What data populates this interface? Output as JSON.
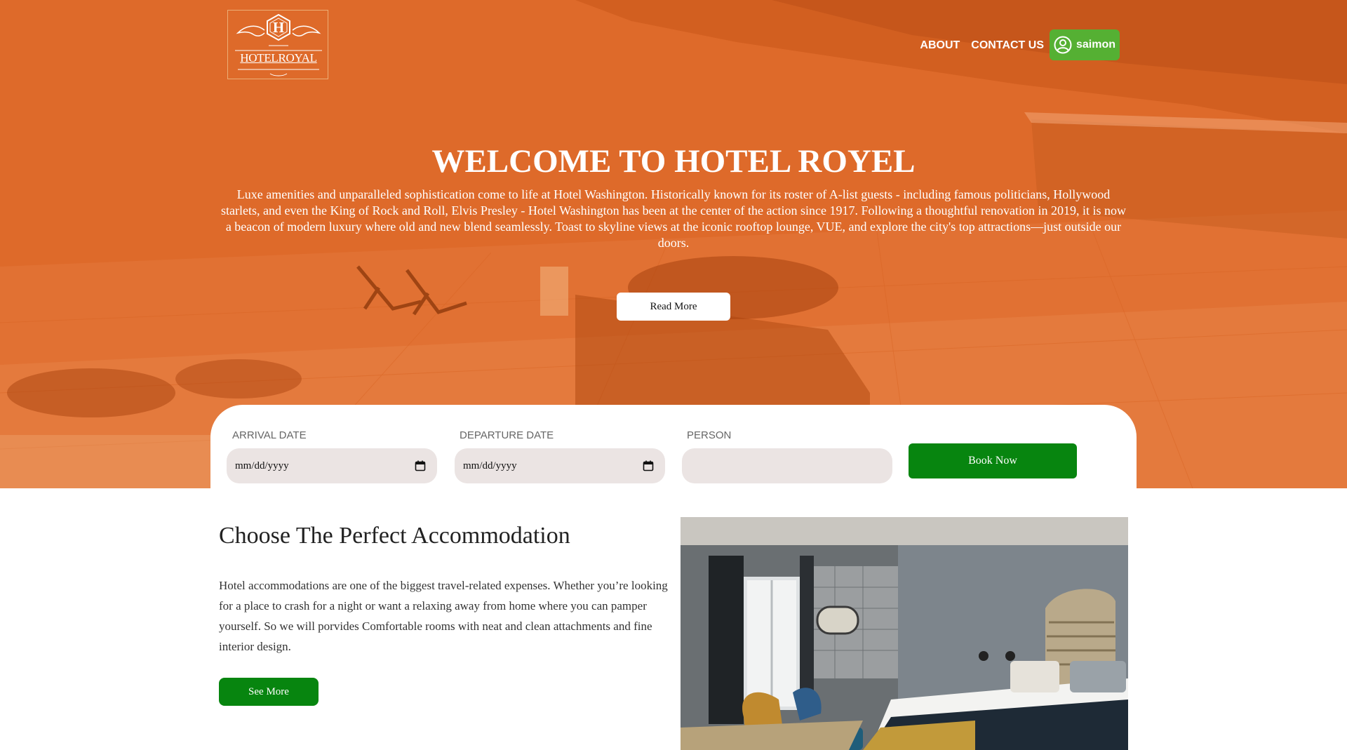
{
  "header": {
    "logo": {
      "text": "HOTELROYAL",
      "letter": "H"
    },
    "nav": {
      "about": "ABOUT",
      "contact": "CONTACT US"
    },
    "user": {
      "name": "saimon",
      "icon": "user-circle-icon"
    }
  },
  "hero": {
    "title": "WELCOME TO HOTEL ROYEL",
    "text": "Luxe amenities and unparalleled sophistication come to life at Hotel Washington. Historically known for its roster of A-list guests - including famous politicians, Hollywood starlets, and even the King of Rock and Roll, Elvis Presley - Hotel Washington has been at the center of the action since 1917. Following a thoughtful renovation in 2019, it is now a beacon of modern luxury where old and new blend seamlessly. Toast to skyline views at the iconic rooftop lounge, VUE, and explore the city's top attractions—just outside our doors.",
    "read_more": "Read More",
    "overlay_color": "#de6a2a"
  },
  "booking": {
    "arrival_label": "ARRIVAL DATE",
    "arrival_value": "mm/dd/yyyy",
    "departure_label": "DEPARTURE DATE",
    "departure_value": "mm/dd/yyyy",
    "person_label": "PERSON",
    "person_value": "",
    "book_button": "Book Now",
    "button_color": "#07850f"
  },
  "accommodation": {
    "title": "Choose The Perfect Accommodation",
    "text": "Hotel accommodations are one of the biggest travel-related expenses. Whether you’re looking for a place to crash for a night or want a relaxing away from home where you can pamper yourself. So we will porvides Comfortable rooms with neat and clean attachments and fine interior design.",
    "see_more": "See More"
  },
  "colors": {
    "accent_green": "#07850f",
    "user_green": "#55b033",
    "field_bg": "#ebe4e3"
  }
}
